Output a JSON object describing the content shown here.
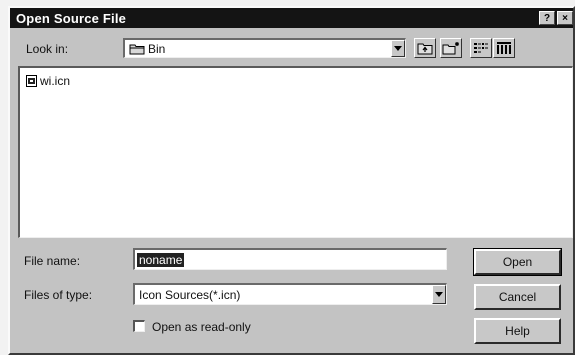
{
  "dialog": {
    "title": "Open Source File",
    "help_glyph": "?",
    "close_glyph": "×"
  },
  "look_in": {
    "label": "Look in:",
    "value": "Bin",
    "icon": "folder-icon"
  },
  "toolbar": {
    "icons": [
      "up-folder-icon",
      "new-folder-icon",
      "list-view-icon",
      "details-view-icon"
    ]
  },
  "files": [
    {
      "name": "wi.icn",
      "icon": "file-icon"
    }
  ],
  "file_name": {
    "label": "File name:",
    "value": "noname"
  },
  "files_of_type": {
    "label": "Files of type:",
    "value": "Icon Sources(*.icn)"
  },
  "read_only": {
    "label": "Open as read-only",
    "checked": false
  },
  "buttons": {
    "open": "Open",
    "cancel": "Cancel",
    "help": "Help"
  }
}
